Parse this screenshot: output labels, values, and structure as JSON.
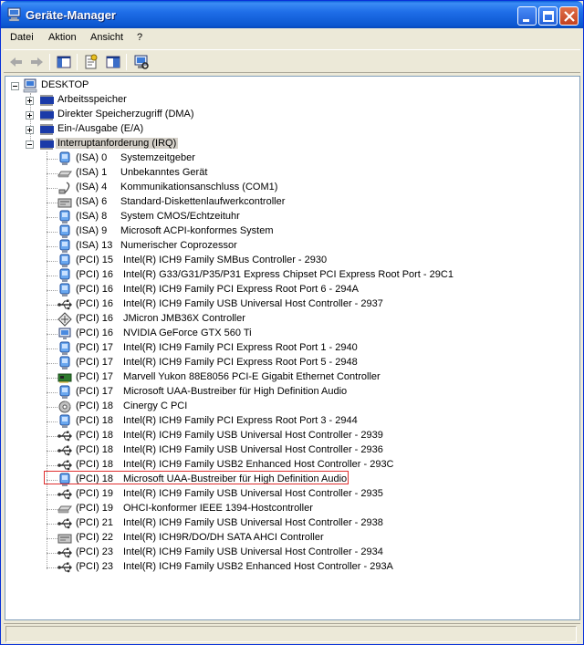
{
  "window": {
    "title": "Geräte-Manager",
    "accent": "#0b57d0"
  },
  "menu": {
    "items": [
      "Datei",
      "Aktion",
      "Ansicht",
      "?"
    ]
  },
  "toolbar": {
    "buttons": [
      "back-icon",
      "forward-icon",
      "show-hide-console-tree-icon",
      "properties-icon",
      "help-icon",
      "scan-hardware-icon"
    ]
  },
  "tree": {
    "root": "DESKTOP",
    "categories": [
      {
        "label": "Arbeitsspeicher",
        "expanded": false
      },
      {
        "label": "Direkter Speicherzugriff (DMA)",
        "expanded": false
      },
      {
        "label": "Ein-/Ausgabe (E/A)",
        "expanded": false
      },
      {
        "label": "Interruptanforderung (IRQ)",
        "expanded": true
      }
    ],
    "irq_items": [
      {
        "irq": "(ISA)  0",
        "device": "Systemzeitgeber",
        "icon": "system-device-icon"
      },
      {
        "irq": "(ISA)  1",
        "device": "Unbekanntes Gerät",
        "icon": "keyboard-icon"
      },
      {
        "irq": "(ISA)  4",
        "device": "Kommunikationsanschluss (COM1)",
        "icon": "port-icon"
      },
      {
        "irq": "(ISA)  6",
        "device": "Standard-Diskettenlaufwerkcontroller",
        "icon": "floppy-controller-icon"
      },
      {
        "irq": "(ISA)  8",
        "device": "System CMOS/Echtzeituhr",
        "icon": "system-device-icon"
      },
      {
        "irq": "(ISA)  9",
        "device": "Microsoft ACPI-konformes System",
        "icon": "system-device-icon"
      },
      {
        "irq": "(ISA) 13",
        "device": "Numerischer Coprozessor",
        "icon": "system-device-icon"
      },
      {
        "irq": "(PCI) 15",
        "device": "Intel(R) ICH9 Family SMBus Controller - 2930",
        "icon": "system-device-icon"
      },
      {
        "irq": "(PCI) 16",
        "device": "Intel(R) G33/G31/P35/P31 Express Chipset PCI Express Root Port - 29C1",
        "icon": "system-device-icon"
      },
      {
        "irq": "(PCI) 16",
        "device": "Intel(R) ICH9 Family PCI Express Root Port 6 - 294A",
        "icon": "system-device-icon"
      },
      {
        "irq": "(PCI) 16",
        "device": "Intel(R) ICH9 Family USB Universal Host Controller - 2937",
        "icon": "usb-icon"
      },
      {
        "irq": "(PCI) 16",
        "device": "JMicron JMB36X Controller",
        "icon": "scsi-icon"
      },
      {
        "irq": "(PCI) 16",
        "device": "NVIDIA GeForce GTX 560 Ti",
        "icon": "display-icon"
      },
      {
        "irq": "(PCI) 17",
        "device": "Intel(R) ICH9 Family PCI Express Root Port 1 - 2940",
        "icon": "system-device-icon"
      },
      {
        "irq": "(PCI) 17",
        "device": "Intel(R) ICH9 Family PCI Express Root Port 5 - 2948",
        "icon": "system-device-icon"
      },
      {
        "irq": "(PCI) 17",
        "device": "Marvell Yukon 88E8056 PCI-E Gigabit Ethernet Controller",
        "icon": "network-icon"
      },
      {
        "irq": "(PCI) 17",
        "device": "Microsoft UAA-Bustreiber für High Definition Audio",
        "icon": "system-device-icon"
      },
      {
        "irq": "(PCI) 18",
        "device": "Cinergy C PCI",
        "icon": "media-icon"
      },
      {
        "irq": "(PCI) 18",
        "device": "Intel(R) ICH9 Family PCI Express Root Port 3 - 2944",
        "icon": "system-device-icon"
      },
      {
        "irq": "(PCI) 18",
        "device": "Intel(R) ICH9 Family USB Universal Host Controller - 2939",
        "icon": "usb-icon"
      },
      {
        "irq": "(PCI) 18",
        "device": "Intel(R) ICH9 Family USB Universal Host Controller - 2936",
        "icon": "usb-icon"
      },
      {
        "irq": "(PCI) 18",
        "device": "Intel(R) ICH9 Family USB2 Enhanced Host Controller - 293C",
        "icon": "usb-icon"
      },
      {
        "irq": "(PCI) 18",
        "device": "Microsoft UAA-Bustreiber für High Definition Audio",
        "icon": "system-device-icon",
        "highlighted": true
      },
      {
        "irq": "(PCI) 19",
        "device": "Intel(R) ICH9 Family USB Universal Host Controller - 2935",
        "icon": "usb-icon"
      },
      {
        "irq": "(PCI) 19",
        "device": "OHCI-konformer IEEE 1394-Hostcontroller",
        "icon": "firewire-icon"
      },
      {
        "irq": "(PCI) 21",
        "device": "Intel(R) ICH9 Family USB Universal Host Controller - 2938",
        "icon": "usb-icon"
      },
      {
        "irq": "(PCI) 22",
        "device": "Intel(R) ICH9R/DO/DH SATA AHCI Controller",
        "icon": "ide-controller-icon"
      },
      {
        "irq": "(PCI) 23",
        "device": "Intel(R) ICH9 Family USB Universal Host Controller - 2934",
        "icon": "usb-icon"
      },
      {
        "irq": "(PCI) 23",
        "device": "Intel(R) ICH9 Family USB2 Enhanced Host Controller - 293A",
        "icon": "usb-icon"
      }
    ]
  },
  "colors": {
    "highlight_border": "#e03030",
    "selection_bg": "#d4d0c8"
  }
}
